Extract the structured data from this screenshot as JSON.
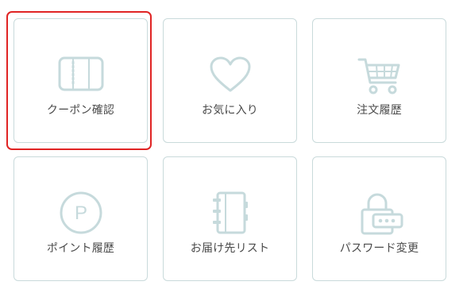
{
  "menu": {
    "items": [
      {
        "label": "クーポン確認",
        "icon": "coupon-book-icon",
        "selected": true
      },
      {
        "label": "お気に入り",
        "icon": "heart-icon",
        "selected": false
      },
      {
        "label": "注文履歴",
        "icon": "cart-icon",
        "selected": false
      },
      {
        "label": "ポイント履歴",
        "icon": "point-circle-icon",
        "selected": false
      },
      {
        "label": "お届け先リスト",
        "icon": "address-book-icon",
        "selected": false
      },
      {
        "label": "パスワード変更",
        "icon": "padlock-icon",
        "selected": false
      }
    ],
    "point_icon_letter": "P"
  },
  "colors": {
    "icon": "#c6dadc",
    "card_border": "#c9dadb",
    "label_text": "#4a4a4a",
    "selection_outline": "#e02424"
  }
}
